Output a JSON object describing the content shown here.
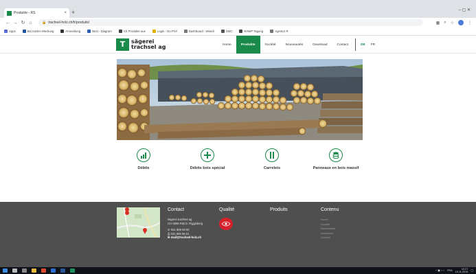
{
  "browser": {
    "tab_title": "Produkte - RS",
    "tab_close": "×",
    "new_tab": "+",
    "window_controls": "–  ▢  ✕",
    "url": "trachsel-holz.ch/fr/produits/",
    "bookmarks": [
      {
        "label": "Apps",
        "color": "#5b6bd6"
      },
      {
        "label": "Bei Karten Werbung",
        "color": "#2455a3"
      },
      {
        "label": "Anmeldung",
        "color": "#333333"
      },
      {
        "label": "Best - Diagram",
        "color": "#2a5db8"
      },
      {
        "label": "Ch Produkte aus",
        "color": "#444444"
      },
      {
        "label": "Login - Do Prof",
        "color": "#e0b000"
      },
      {
        "label": "Dashboard - Wiredi",
        "color": "#7a7a7a"
      },
      {
        "label": "SMC",
        "color": "#555555"
      },
      {
        "label": "RAWP Tagung",
        "color": "#444444"
      },
      {
        "label": "Agentur R",
        "color": "#777777"
      }
    ]
  },
  "site": {
    "logo_line1": "sägerei",
    "logo_line2": "trachsel ag",
    "nav": [
      {
        "label": "Home",
        "active": false
      },
      {
        "label": "Produkte",
        "active": true
      },
      {
        "label": "Société",
        "active": false
      },
      {
        "label": "Nouveautés",
        "active": false
      },
      {
        "label": "Download",
        "active": false
      },
      {
        "label": "Contact",
        "active": false
      }
    ],
    "languages": [
      {
        "label": "DE",
        "active": true
      },
      {
        "label": "FR",
        "active": false
      }
    ]
  },
  "categories": [
    {
      "label": "Débits",
      "icon": "bar-chart-icon"
    },
    {
      "label": "Débits bois spécial",
      "icon": "plus-icon"
    },
    {
      "label": "Carrelets",
      "icon": "pause-icon"
    },
    {
      "label": "Panneaux en bois massif",
      "icon": "stack-icon"
    }
  ],
  "footer": {
    "contact_title": "Contact",
    "contact_lines": [
      "sägerei trachsel ag",
      "CH-3095 Rüti b. Riggisberg"
    ],
    "phone": "031 809 09 00",
    "fax": "031 809 09 01",
    "email": "mail@trachsel-holz.ch",
    "quality_title": "Qualité",
    "produits_title": "Produits",
    "contenu_title": "Contenu",
    "contenu_links": [
      "Home",
      "Société",
      "Nouveautés",
      "Download",
      "Contact"
    ]
  },
  "taskbar": {
    "time": "10:27",
    "date": "15.11.2019",
    "lang": "FRA"
  },
  "colors": {
    "brand_green": "#1a8a4a",
    "footer_bg": "#4f4f4f"
  }
}
